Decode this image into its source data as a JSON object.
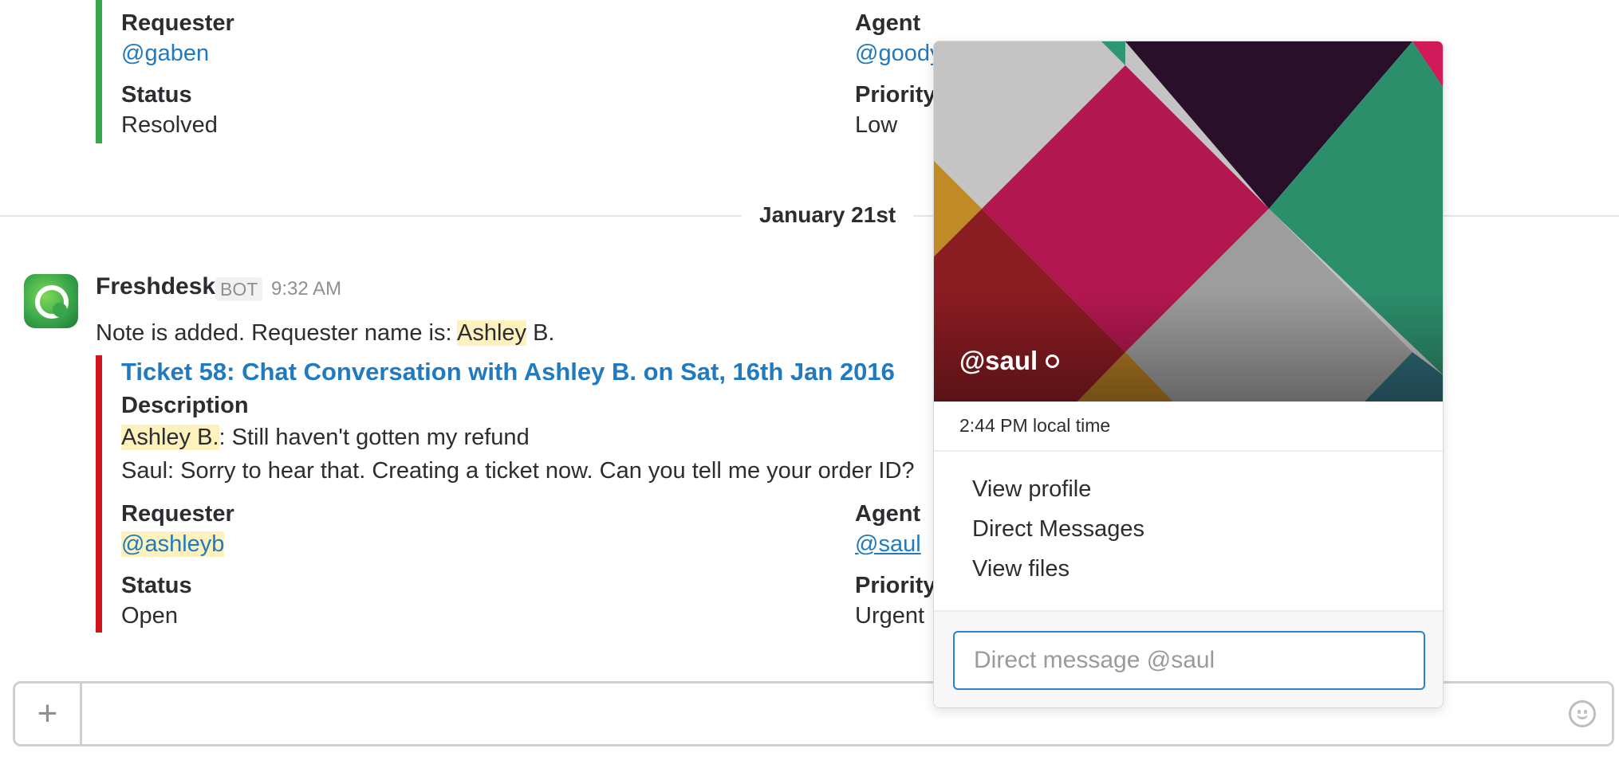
{
  "top_ticket": {
    "requester_label": "Requester",
    "requester_value": "@gaben",
    "agent_label": "Agent",
    "agent_value": "@goody",
    "status_label": "Status",
    "status_value": "Resolved",
    "priority_label": "Priority",
    "priority_value": "Low"
  },
  "day_divider": "January 21st",
  "message": {
    "sender": "Freshdesk",
    "badge": "BOT",
    "time": "9:32 AM",
    "text_prefix": "Note is added. Requester name is: ",
    "text_highlight": "Ashley",
    "text_suffix": " B."
  },
  "ticket": {
    "title": "Ticket 58: Chat Conversation with Ashley B. on Sat, 16th Jan 2016",
    "description_label": "Description",
    "line1_highlight": "Ashley B.",
    "line1_rest": ": Still haven't gotten my refund",
    "line2": "Saul: Sorry to hear that. Creating a ticket now. Can you tell me your order ID?",
    "requester_label": "Requester",
    "requester_value": "@ashleyb",
    "agent_label": "Agent",
    "agent_value": "@saul",
    "status_label": "Status",
    "status_value": "Open",
    "priority_label": "Priority",
    "priority_value": "Urgent"
  },
  "popover": {
    "username": "@saul",
    "local_time": "2:44 PM local time",
    "menu": [
      "View profile",
      "Direct Messages",
      "View files"
    ],
    "dm_placeholder": "Direct message @saul"
  },
  "composer": {
    "plus_label": "+",
    "emoji_icon": "smiley-icon"
  },
  "colors": {
    "link": "#1f7ac0",
    "highlight": "#fdf2bd",
    "green_bar": "#3aa64b",
    "red_bar": "#d0141c",
    "focus": "#2d7fd3"
  }
}
